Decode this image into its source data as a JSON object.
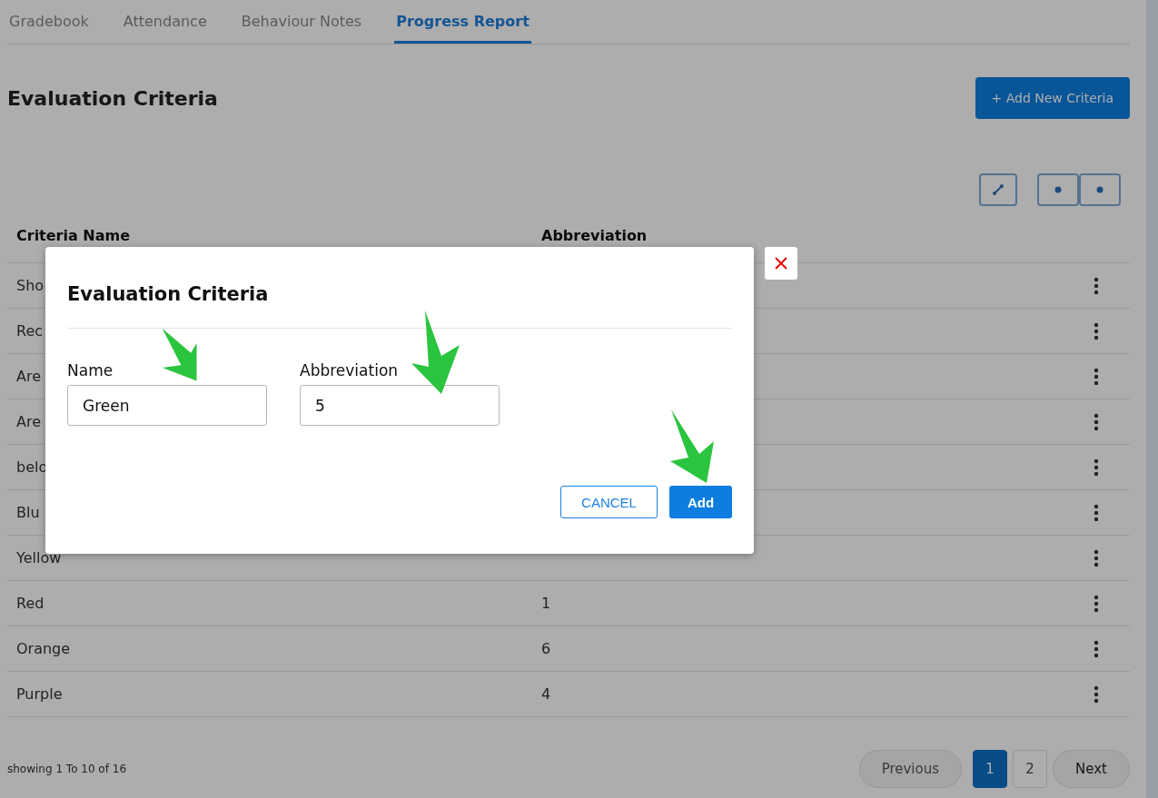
{
  "tabs": [
    {
      "label": "Gradebook",
      "selected": false
    },
    {
      "label": "Attendance",
      "selected": false
    },
    {
      "label": "Behaviour Notes",
      "selected": false
    },
    {
      "label": "Progress Report",
      "selected": true
    }
  ],
  "page_title": "Evaluation Criteria",
  "add_button": "+ Add New Criteria",
  "table": {
    "columns": [
      "Criteria Name",
      "Abbreviation"
    ],
    "rows": [
      {
        "name": "Sho"
      },
      {
        "name": "Rec"
      },
      {
        "name": "Are"
      },
      {
        "name": "Are"
      },
      {
        "name": "belo"
      },
      {
        "name": "Blu"
      },
      {
        "name": "Yellow"
      },
      {
        "name": "Red",
        "abbreviation": "1"
      },
      {
        "name": "Orange",
        "abbreviation": "6"
      },
      {
        "name": "Purple",
        "abbreviation": "4"
      }
    ]
  },
  "footer": {
    "summary": "showing 1 To 10 of 16",
    "previous": "Previous",
    "pages": [
      {
        "label": "1",
        "selected": true
      },
      {
        "label": "2",
        "selected": false
      }
    ],
    "next": "Next"
  },
  "dialog": {
    "title": "Evaluation Criteria",
    "fields": [
      {
        "label": "Name",
        "value": "Green"
      },
      {
        "label": "Abbreviation",
        "value": "5"
      }
    ],
    "cancel": "CANCEL",
    "confirm": "Add"
  }
}
